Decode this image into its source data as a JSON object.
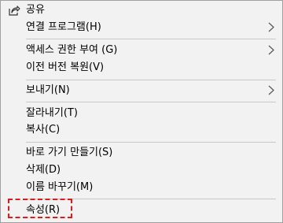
{
  "menu": {
    "items": [
      {
        "label": "공유",
        "has_submenu": false,
        "icon": "share-icon"
      },
      {
        "label": "연결 프로그램(H)",
        "has_submenu": true
      },
      {
        "label": "액세스 권한 부여 (G)",
        "has_submenu": true
      },
      {
        "label": "이전 버전 복원(V)",
        "has_submenu": false
      },
      {
        "label": "보내기(N)",
        "has_submenu": true
      },
      {
        "label": "잘라내기(T)",
        "has_submenu": false
      },
      {
        "label": "복사(C)",
        "has_submenu": false
      },
      {
        "label": "바로 가기 만들기(S)",
        "has_submenu": false
      },
      {
        "label": "삭제(D)",
        "has_submenu": false
      },
      {
        "label": "이름 바꾸기(M)",
        "has_submenu": false
      },
      {
        "label": "속성(R)",
        "has_submenu": false,
        "highlighted": true
      }
    ]
  },
  "colors": {
    "menu_bg": "#f2f2f2",
    "separator": "#c8c8c8",
    "highlight_border": "#e11a1a"
  }
}
